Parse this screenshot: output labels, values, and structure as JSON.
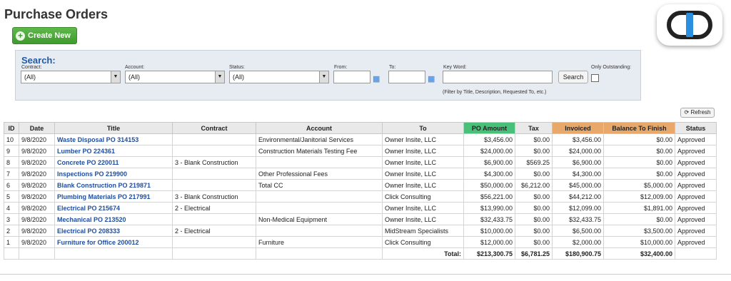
{
  "header": {
    "title": "Purchase Orders",
    "create_label": "Create New"
  },
  "search": {
    "title": "Search:",
    "contract_label": "Contract:",
    "contract_value": "(All)",
    "account_label": "Account:",
    "account_value": "(All)",
    "status_label": "Status:",
    "status_value": "(All)",
    "from_label": "From:",
    "to_label": "To:",
    "keyword_label": "Key Word:",
    "search_button": "Search",
    "outstanding_label": "Only Outstanding:",
    "hint": "(Filter by Title, Description, Requested To, etc.)"
  },
  "refresh_label": "Refresh",
  "table": {
    "columns": [
      "ID",
      "Date",
      "Title",
      "Contract",
      "Account",
      "To",
      "PO Amount",
      "Tax",
      "Invoiced",
      "Balance To Finish",
      "Status"
    ],
    "rows": [
      [
        "10",
        "9/8/2020",
        "Waste Disposal PO 314153",
        "",
        "Environmental/Janitorial Services",
        "Owner Insite, LLC",
        "$3,456.00",
        "$0.00",
        "$3,456.00",
        "$0.00",
        "Approved"
      ],
      [
        "9",
        "9/8/2020",
        "Lumber PO 224361",
        "",
        "Construction Materials Testing Fee",
        "Owner Insite, LLC",
        "$24,000.00",
        "$0.00",
        "$24,000.00",
        "$0.00",
        "Approved"
      ],
      [
        "8",
        "9/8/2020",
        "Concrete PO 220011",
        "3 - Blank Construction",
        "",
        "Owner Insite, LLC",
        "$6,900.00",
        "$569.25",
        "$6,900.00",
        "$0.00",
        "Approved"
      ],
      [
        "7",
        "9/8/2020",
        "Inspections PO 219900",
        "",
        "Other Professional Fees",
        "Owner Insite, LLC",
        "$4,300.00",
        "$0.00",
        "$4,300.00",
        "$0.00",
        "Approved"
      ],
      [
        "6",
        "9/8/2020",
        "Blank Construction PO 219871",
        "",
        "Total CC",
        "Owner Insite, LLC",
        "$50,000.00",
        "$6,212.00",
        "$45,000.00",
        "$5,000.00",
        "Approved"
      ],
      [
        "5",
        "9/8/2020",
        "Plumbing Materials PO 217991",
        "3 - Blank Construction",
        "",
        "Click Consulting",
        "$56,221.00",
        "$0.00",
        "$44,212.00",
        "$12,009.00",
        "Approved"
      ],
      [
        "4",
        "9/8/2020",
        "Electrical PO 215674",
        "2 - Electrical",
        "",
        "Owner Insite, LLC",
        "$13,990.00",
        "$0.00",
        "$12,099.00",
        "$1,891.00",
        "Approved"
      ],
      [
        "3",
        "9/8/2020",
        "Mechanical PO 213520",
        "",
        "Non-Medical Equipment",
        "Owner Insite, LLC",
        "$32,433.75",
        "$0.00",
        "$32,433.75",
        "$0.00",
        "Approved"
      ],
      [
        "2",
        "9/8/2020",
        "Electrical PO 208333",
        "2 - Electrical",
        "",
        "MidStream Specialists",
        "$10,000.00",
        "$0.00",
        "$6,500.00",
        "$3,500.00",
        "Approved"
      ],
      [
        "1",
        "9/8/2020",
        "Furniture for Office 200012",
        "",
        "Furniture",
        "Click Consulting",
        "$12,000.00",
        "$0.00",
        "$2,000.00",
        "$10,000.00",
        "Approved"
      ]
    ],
    "total_label": "Total:",
    "totals": [
      "$213,300.75",
      "$6,781.25",
      "$180,900.75",
      "$32,400.00"
    ]
  },
  "colors": {
    "po_amount_header": "#49c07a",
    "invoiced_header": "#e8a86a",
    "link": "#1f4fa0",
    "create_button": "#4caa3a"
  }
}
